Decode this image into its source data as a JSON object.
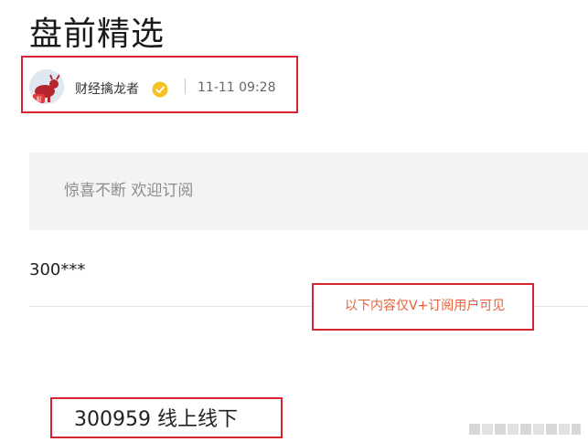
{
  "page": {
    "title": "盘前精选"
  },
  "author": {
    "name": "财经擒龙者",
    "time": "11-11 09:28",
    "avatar_icon": "bull-avatar-icon",
    "verified_icon": "verified-badge-icon",
    "verified_color": "#f5c022"
  },
  "banner": {
    "text": "惊喜不断 欢迎订阅"
  },
  "content": {
    "stock_code": "300***",
    "paywall_notice": "以下内容仅V+订阅用户可见",
    "highlight": "300959 线上线下"
  },
  "colors": {
    "annotation_box": "#d6252f",
    "paywall_text": "#e7603a",
    "banner_bg": "#f3f3f3"
  }
}
